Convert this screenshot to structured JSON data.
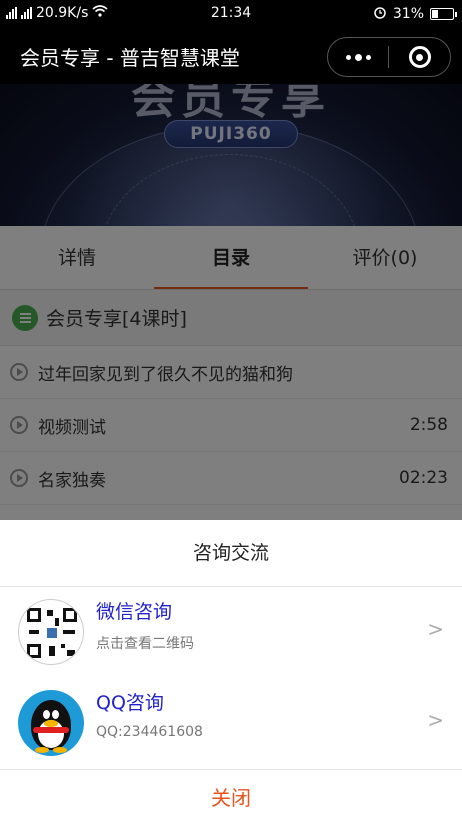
{
  "status_bar": {
    "speed": "20.9K/s",
    "time": "21:34",
    "battery_percent": "31%",
    "battery_level": 0.31
  },
  "title_bar": {
    "title": "会员专享 - 普吉智慧课堂"
  },
  "banner": {
    "heading": "会员专享",
    "tag": "PUJI360"
  },
  "tabs": [
    {
      "label": "详情"
    },
    {
      "label": "目录"
    },
    {
      "label": "评价(0)"
    }
  ],
  "section": {
    "title": "会员专享[4课时]"
  },
  "lessons": [
    {
      "name": "过年回家见到了很久不见的猫和狗",
      "duration": ""
    },
    {
      "name": "视频测试",
      "duration": "2:58"
    },
    {
      "name": "名家独奏",
      "duration": "02:23"
    }
  ],
  "sheet": {
    "title": "咨询交流",
    "items": [
      {
        "label": "微信咨询",
        "sub": "点击查看二维码",
        "icon": "qr-code-icon"
      },
      {
        "label": "QQ咨询",
        "sub": "QQ:234461608",
        "icon": "qq-penguin-icon"
      }
    ],
    "close_label": "关闭"
  },
  "colors": {
    "accent": "#e8541e",
    "link": "#2222cc",
    "section_icon": "#4caf50"
  }
}
